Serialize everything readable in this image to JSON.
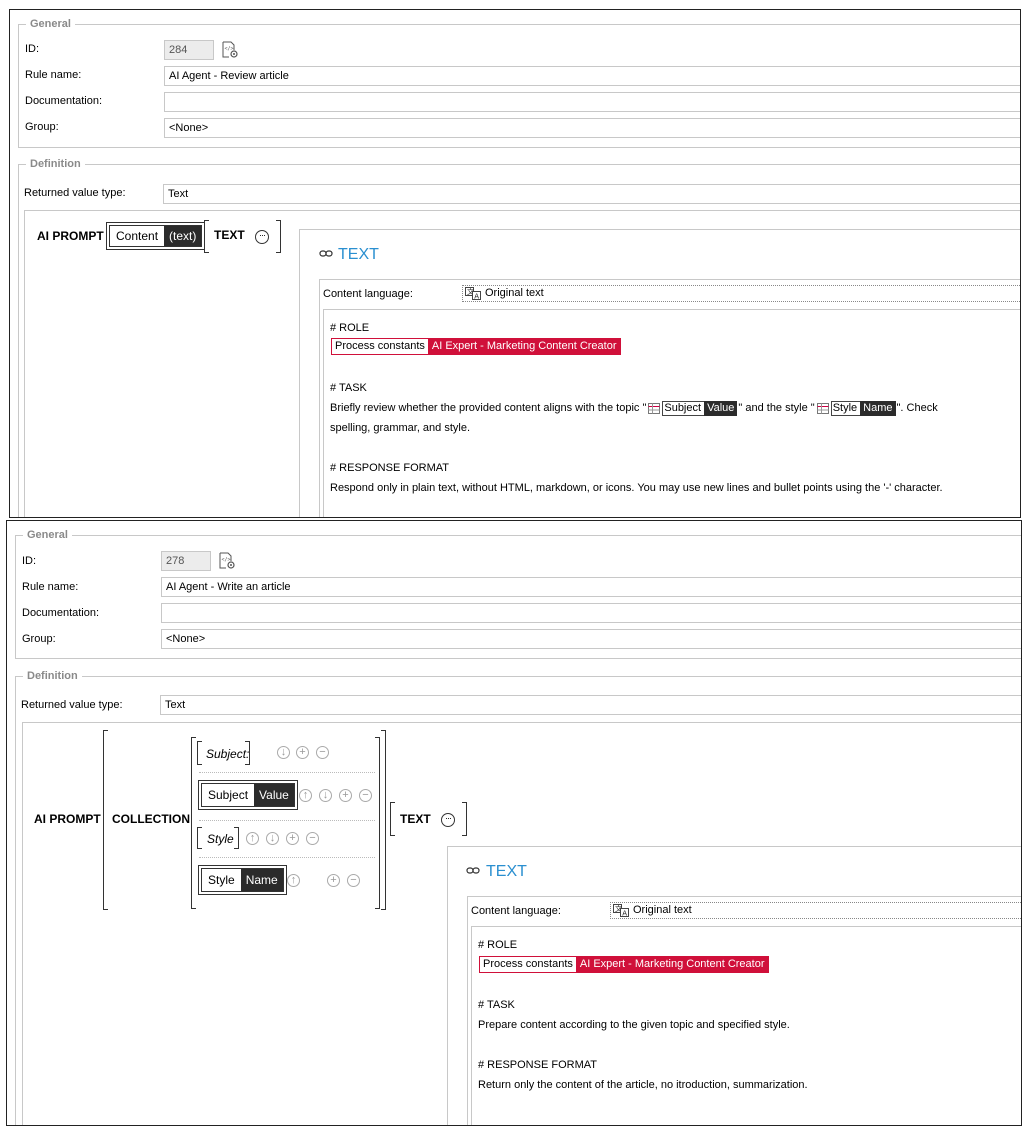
{
  "top": {
    "general_legend": "General",
    "id_label": "ID:",
    "id_value": "284",
    "rule_label": "Rule name:",
    "rule_value": "AI Agent - Review article",
    "doc_label": "Documentation:",
    "doc_value": "",
    "group_label": "Group:",
    "group_value": "<None>",
    "definition_legend": "Definition",
    "returned_label": "Returned value type:",
    "returned_value": "Text",
    "ai_prompt": "AI PROMPT",
    "chip_key": "Content",
    "chip_value": "(text)",
    "text_kw": "TEXT",
    "text_title": "TEXT",
    "content_lang_label": "Content language:",
    "content_lang_value": "Original text",
    "role_heading": "# ROLE",
    "const_key": "Process constants",
    "const_value": "AI Expert - Marketing Content Creator",
    "task_heading": "# TASK",
    "task_pre": "Briefly review whether the provided content aligns with the topic \"",
    "subject_key": "Subject",
    "subject_val": "Value",
    "task_mid": "\" and the style \"",
    "style_key": "Style",
    "style_val": "Name",
    "task_post": "\". Check",
    "task_line2": "spelling, grammar, and style.",
    "resp_heading": "# RESPONSE FORMAT",
    "resp_text": "Respond only in plain text, without HTML, markdown, or icons. You may use new lines and bullet points using the '-' character."
  },
  "bottom": {
    "general_legend": "General",
    "id_label": "ID:",
    "id_value": "278",
    "rule_label": "Rule name:",
    "rule_value": "AI Agent - Write an article",
    "doc_label": "Documentation:",
    "doc_value": "",
    "group_label": "Group:",
    "group_value": "<None>",
    "definition_legend": "Definition",
    "returned_label": "Returned value type:",
    "returned_value": "Text",
    "ai_prompt": "AI PROMPT",
    "collection": "COLLECTION",
    "item1": "Subject:",
    "item2_key": "Subject",
    "item2_val": "Value",
    "item3": "Style",
    "item4_key": "Style",
    "item4_val": "Name",
    "text_kw": "TEXT",
    "text_title": "TEXT",
    "content_lang_label": "Content language:",
    "content_lang_value": "Original text",
    "role_heading": "# ROLE",
    "const_key": "Process constants",
    "const_value": "AI Expert - Marketing Content Creator",
    "task_heading": "# TASK",
    "task_text": "Prepare content according to the given topic and specified style.",
    "resp_heading": "# RESPONSE FORMAT",
    "resp_text": "Return only the content of the article, no itroduction, summarization."
  },
  "icons": {
    "gear": "gear-icon",
    "link": "link-icon",
    "translate": "translate-icon",
    "table": "table-icon",
    "ellipsis": "ellipsis-icon",
    "move_up": "arrow-up-icon",
    "move_down": "arrow-down-icon",
    "add": "plus-icon",
    "remove": "minus-icon"
  },
  "colors": {
    "accent_title": "#2a8fd0",
    "constant_red": "#d0103a",
    "value_dark": "#2b2b2b"
  }
}
